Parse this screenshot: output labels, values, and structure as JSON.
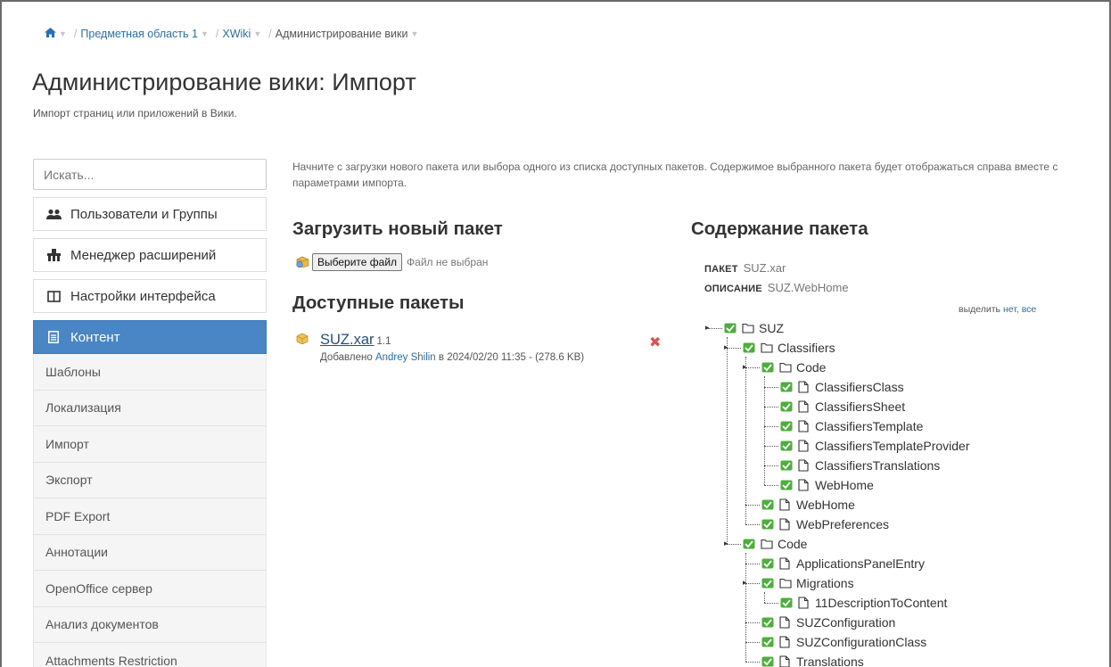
{
  "breadcrumb": {
    "items": [
      "Предметная область 1",
      "XWiki",
      "Администрирование вики"
    ]
  },
  "page": {
    "title": "Администрирование вики: Импорт",
    "subtitle": "Импорт страниц или приложений в Вики."
  },
  "sidebar": {
    "search_placeholder": "Искать...",
    "categories": [
      {
        "label": "Пользователи и Группы",
        "icon": "users-icon"
      },
      {
        "label": "Менеджер расширений",
        "icon": "extensions-icon"
      },
      {
        "label": "Настройки интерфейса",
        "icon": "layout-icon"
      },
      {
        "label": "Контент",
        "icon": "content-icon",
        "active": true
      }
    ],
    "items": [
      "Шаблоны",
      "Локализация",
      "Импорт",
      "Экспорт",
      "PDF Export",
      "Аннотации",
      "OpenOffice сервер",
      "Анализ документов",
      "Attachments Restriction"
    ]
  },
  "main": {
    "intro": "Начните с загрузки нового пакета или выбора одного из списка доступных пакетов. Содержимое выбранного пакета будет отображаться справа вместе с параметрами импорта.",
    "upload_heading": "Загрузить новый пакет",
    "file_button": "Выберите файл",
    "file_status": "Файл не выбран",
    "available_heading": "Доступные пакеты",
    "package": {
      "name": "SUZ.xar",
      "version": "1.1",
      "added_prefix": "Добавлено",
      "author": "Andrey Shilin",
      "added_suffix": "в 2024/02/20 11:35 - (278.6 KB)"
    }
  },
  "content": {
    "heading": "Содержание пакета",
    "package_label": "ПАКЕТ",
    "package_value": "SUZ.xar",
    "description_label": "ОПИСАНИЕ",
    "description_value": "SUZ.WebHome",
    "select_label": "выделить",
    "select_none": "нет,",
    "select_all": "все",
    "tree": [
      {
        "label": "SUZ",
        "type": "folder",
        "level": 0
      },
      {
        "label": "Classifiers",
        "type": "folder",
        "level": 1
      },
      {
        "label": "Code",
        "type": "folder",
        "level": 2
      },
      {
        "label": "ClassifiersClass",
        "type": "page",
        "level": 3
      },
      {
        "label": "ClassifiersSheet",
        "type": "page",
        "level": 3
      },
      {
        "label": "ClassifiersTemplate",
        "type": "page",
        "level": 3
      },
      {
        "label": "ClassifiersTemplateProvider",
        "type": "page",
        "level": 3
      },
      {
        "label": "ClassifiersTranslations",
        "type": "page",
        "level": 3
      },
      {
        "label": "WebHome",
        "type": "page",
        "level": 3
      },
      {
        "label": "WebHome",
        "type": "page",
        "level": 2
      },
      {
        "label": "WebPreferences",
        "type": "page",
        "level": 2
      },
      {
        "label": "Code",
        "type": "folder",
        "level": 1
      },
      {
        "label": "ApplicationsPanelEntry",
        "type": "page",
        "level": 2
      },
      {
        "label": "Migrations",
        "type": "folder",
        "level": 2
      },
      {
        "label": "11DescriptionToContent",
        "type": "page",
        "level": 3
      },
      {
        "label": "SUZConfiguration",
        "type": "page",
        "level": 2
      },
      {
        "label": "SUZConfigurationClass",
        "type": "page",
        "level": 2
      },
      {
        "label": "Translations",
        "type": "page",
        "level": 2
      }
    ]
  },
  "colors": {
    "accent": "#4a86c6",
    "link": "#2a6fb5",
    "check": "#4caf3b",
    "delete": "#d9534f"
  }
}
